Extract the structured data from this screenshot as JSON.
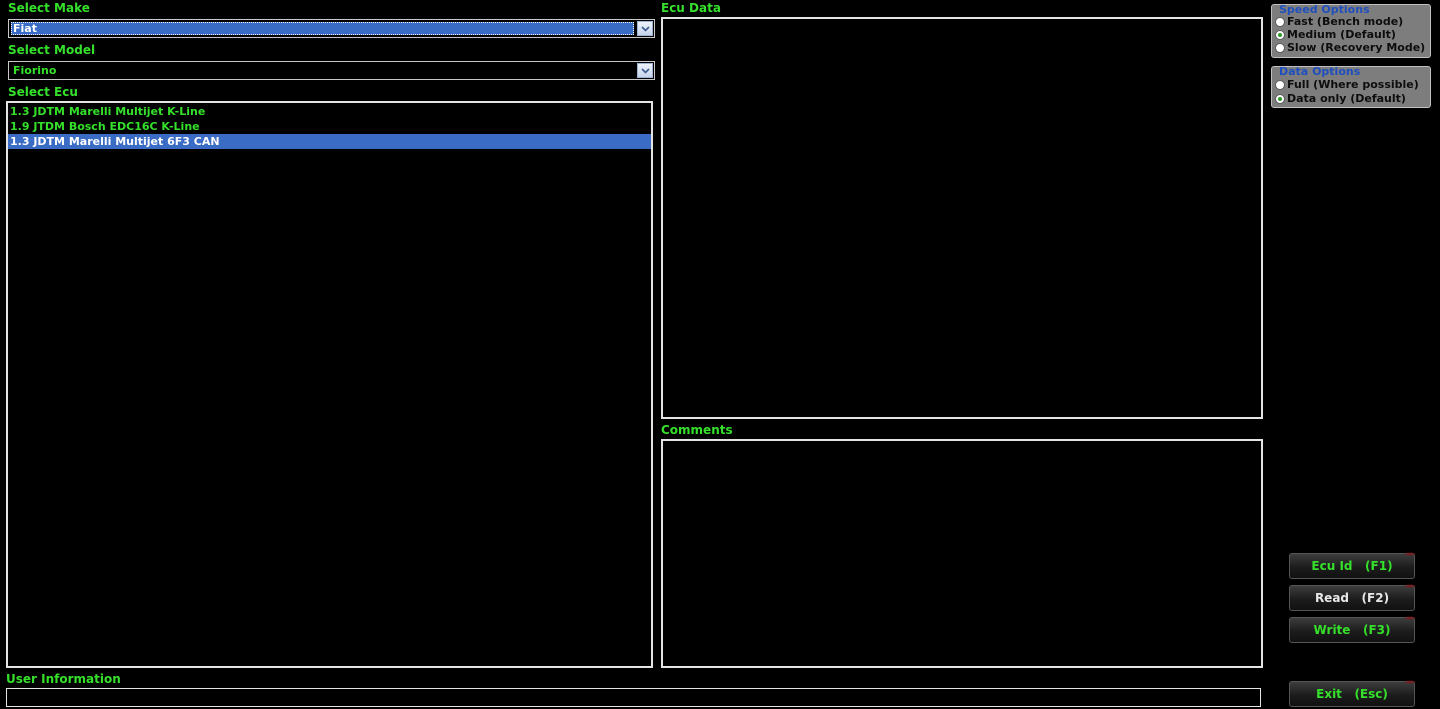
{
  "make": {
    "label": "Select Make",
    "value": "Fiat"
  },
  "model": {
    "label": "Select Model",
    "value": "Fiorino"
  },
  "ecu": {
    "label": "Select Ecu",
    "items": [
      "1.3 JDTM Marelli Multijet K-Line",
      "1.9 JTDM Bosch EDC16C K-Line",
      "1.3 JDTM Marelli Multijet 6F3 CAN"
    ],
    "selected_index": 2
  },
  "ecu_data": {
    "label": "Ecu Data"
  },
  "comments": {
    "label": "Comments"
  },
  "user_info": {
    "label": "User Information"
  },
  "speed_options": {
    "title": "Speed Options",
    "options": [
      "Fast (Bench mode)",
      "Medium (Default)",
      "Slow (Recovery Mode)"
    ],
    "selected_index": 1
  },
  "data_options": {
    "title": "Data Options",
    "options": [
      "Full (Where possible)",
      "Data only (Default)"
    ],
    "selected_index": 1
  },
  "buttons": {
    "ecu_id": "Ecu Id   (F1)",
    "read": "Read   (F2)",
    "write": "Write   (F3)",
    "exit": "Exit   (Esc)"
  },
  "colors": {
    "label_green": "#35e02b",
    "selection_blue": "#3a6cc5",
    "group_title_blue": "#1f4fbf",
    "panel_gray": "#7d7d7d"
  }
}
